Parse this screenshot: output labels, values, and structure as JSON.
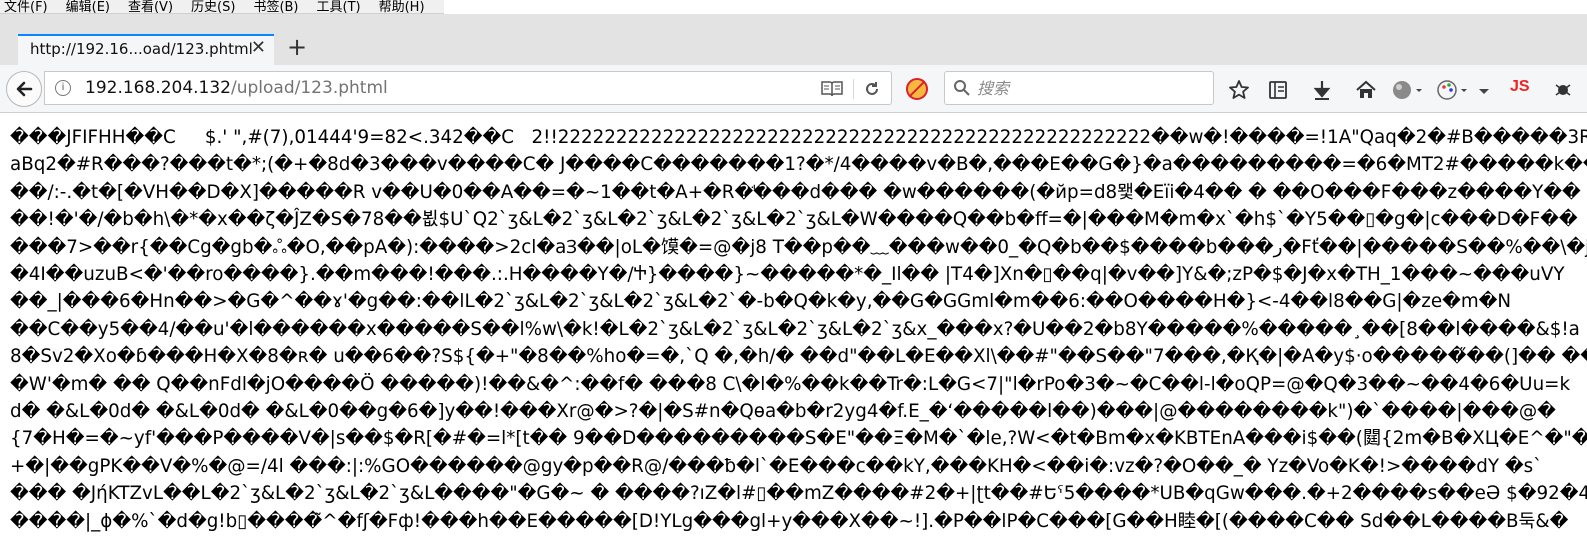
{
  "menubar": {
    "items": [
      "文件(F)",
      "编辑(E)",
      "查看(V)",
      "历史(S)",
      "书签(B)",
      "工具(T)",
      "帮助(H)"
    ]
  },
  "tabs": [
    {
      "title": "http://192.16...oad/123.phtml",
      "close_icon": "close-icon"
    }
  ],
  "new_tab_label": "+",
  "urlbar": {
    "host": "192.168.204.132",
    "path": "/upload/123.phtml"
  },
  "search": {
    "placeholder": "搜索"
  },
  "toolbar_badge": "JS",
  "content_lines": [
    "���JFIFHH��C     $.' \",#(7),01444'9=82<.342��C   2!!222222222222222222222222222222222222222222222222222��w�!����=!1A\"Qaq�2�#B�����3R",
    "aBq2�#R���?���t�*;(�+�8d�3���v����C� J����C�������1?�*/4����v�B�,���E��G�}�a���������=�6�MT2#�����k��",
    "��/:-.�t�[�VH��D�X]�����R v��U�0��A��=�~1��t�A+�R�ꜗ���d��� �w������(�йр=d8뫷�Eїi�4�� � ��O���F���z����Y��",
    "��!�'�/�b�h\\�*�x��ζ�ĴZ�S�78��뵚$Ս`Q2`ʒ&L�2`ʒ&L�2`ʒ&L�2`ʒ&L�2`ʒ&L�W����Q��b�ff=�|���M�m�x`�h$`�Y5��▯�g�|c���D�F��",
    "���7>��r{��Cg�gb�ஃ�O,��pA�):����>2cl�aꞫ��|oL�馍�=@�j8 T��p��﹏���w��0_�Q�b��$����b���ر�Fť��|�����S��%��\\�j",
    "�4I��uzuB<�'��ro����}.��m���!���.:.H����Y�/Ⴕ}����}~�����*�_Il�� |T4�]Xn�▯��q|�v��]Y&�;zP�$�J�x�TH_1���~���uVY",
    "��_|���6�Hn��>�G�^��ɤ'�g��:��lL�2`ʒ&L�2`ʒ&L�2`ʒ&L�2`�-b�Q�k�y,��G�GGml�m��6:��O����H�}<-4��l8��G|�ze�m�N",
    "��C��y5��4/��u'�l������x�����S��l%w\\�k!�L�2`ʒ&L�2`ʒ&L�2`ʒ&L�2`ʒ&x_���x?�U��2�b8Y�����%�����¸��[8��l����&$!a",
    "8�Sv2�Xo�ɓ���H�X�8�ʀ� u��6��?S${�+\"�8��%ho�=�,`Q �,�h/� ��d\"��L�E��Xl\\��#\"��S��\"7���,�Қ�|�A�y$·o�����̋��(]�� ��",
    "�W'�m� �� Q��nFdl�jO����Ö �����)!��&�^:��f� ���8 C\\�l�%��k��Tr�:L�G<7|\"l�rPo�3�~�C��l-l�oQP=@�Q�3��~��4�6�Uu=k",
    "d� �&L�0d� �&L�0d� �&L�0��g�6�]y��!���Xr@�>?�|�S#n�Qɵa�b�r2yg4�f.E_�ʻ�����l��)���|@��������k\")�`����|���@�",
    "{7�H�=�~yf'���P����V�|s��$�R[�#�=l*[t�� 9��D���������S�E\"��Ξ�M�`�le,?W<�t�Bm�x�KBTEnA���i$��(閮{2m�B�XЦ�E^�\"�",
    "+�|��gPK��V�%�@=/4l ���:|:%GO������@gy�p��R@/���ƀ�l`�E���c��kY,���KH�<��i�:vz�?�O��_� Yz�Vo�K�!>����dY �s`",
    "��� �JήKTZvL��L�2`ʒ&L�2`ʒ&L�2`ʒ&L����\"�G�~ � ����?ıZ�l#▯��mZ����#2�+|ʈt��#Եˁ5����*UB�qGw���.�+2����s��eƏ $�92�4",
    "����|_ɸ�%`�d�g!b▯����̃^�fʃ�Fф!���h��E�����[D!YLg���gl+y���X��~!].�P��lP�C���[G��H睦�[(����C�� Sd��L����B둑&�"
  ]
}
